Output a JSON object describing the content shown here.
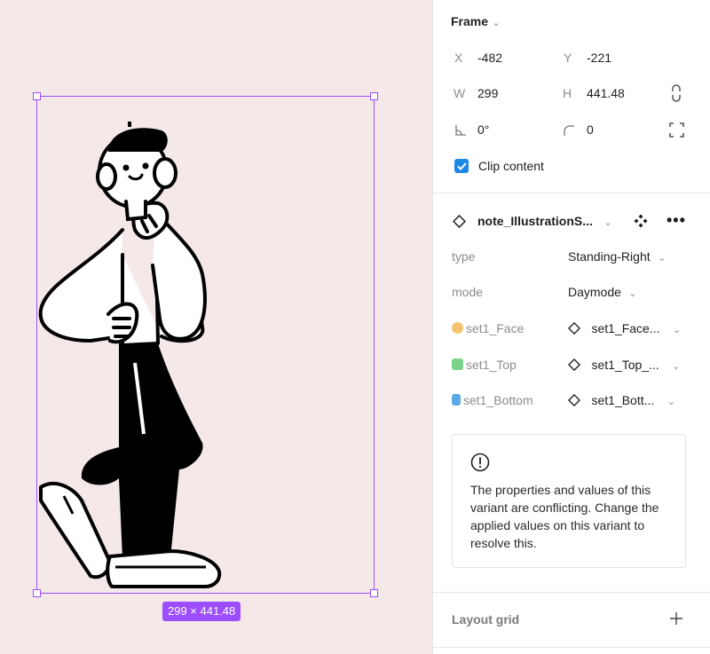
{
  "canvas": {
    "size_badge": "299 × 441.48",
    "selection_color": "#9b4dff",
    "background_color": "#f5e8e8"
  },
  "frame": {
    "title": "Frame",
    "x_label": "X",
    "x_value": "-482",
    "y_label": "Y",
    "y_value": "-221",
    "w_label": "W",
    "w_value": "299",
    "h_label": "H",
    "h_value": "441.48",
    "rotation_value": "0°",
    "radius_value": "0",
    "clip_content_label": "Clip content",
    "clip_content_checked": true
  },
  "component": {
    "name": "note_IllustrationS...",
    "props": [
      {
        "label": "type",
        "value": "Standing-Right"
      },
      {
        "label": "mode",
        "value": "Daymode"
      }
    ],
    "instances": [
      {
        "label": "set1_Face",
        "value": "set1_Face...",
        "icon": "face-icon",
        "color": "#f2c46f"
      },
      {
        "label": "set1_Top",
        "value": "set1_Top_...",
        "icon": "shirt-icon",
        "color": "#7bd389"
      },
      {
        "label": "set1_Bottom",
        "value": "set1_Bott...",
        "icon": "pants-icon",
        "color": "#5aa9e6"
      }
    ],
    "conflict_message": "The properties and values of this variant are conflicting. Change the applied values on this variant to resolve this."
  },
  "layout_grid": {
    "title": "Layout grid"
  }
}
